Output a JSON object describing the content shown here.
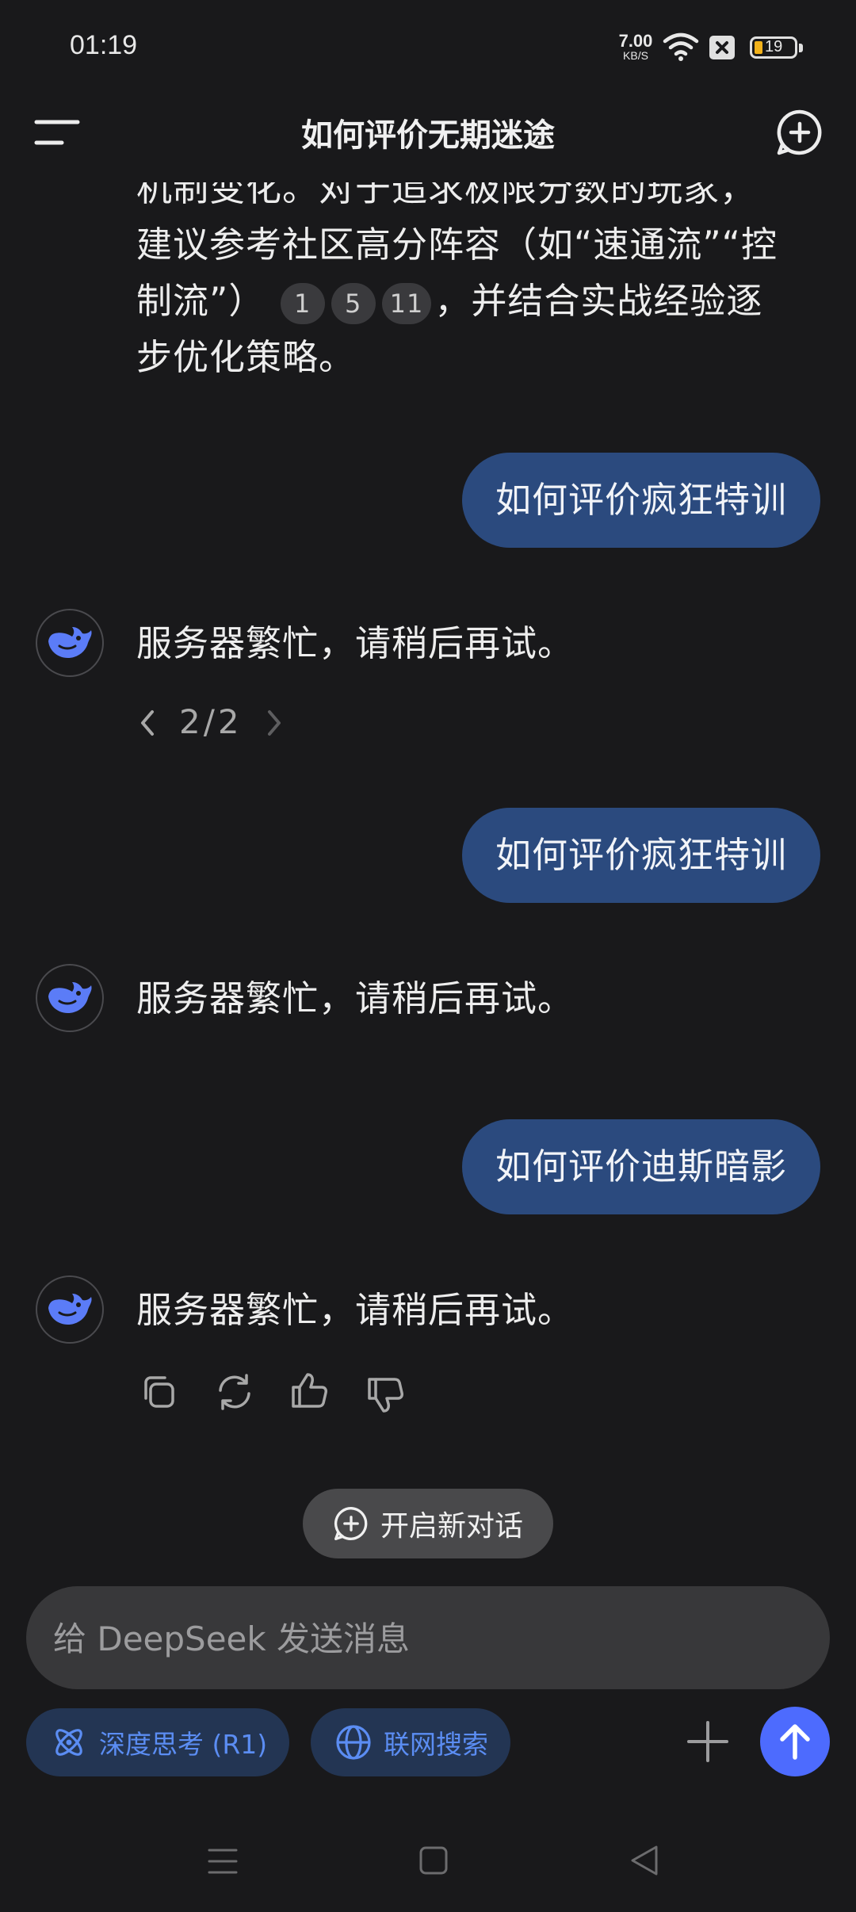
{
  "status_bar": {
    "time": "01:19",
    "net_speed_value": "7.00",
    "net_speed_unit": "KB/S",
    "battery_level": "19"
  },
  "header": {
    "title": "如何评价无期迷途"
  },
  "messages": {
    "partial_answer": {
      "line1": "机制变化。对于追求极限分数的玩家，",
      "line2": "建议参考社区高分阵容（如“速通流”“控",
      "line3_prefix": "制流”）",
      "line3_suffix": "，并结合实战经验逐",
      "line4": "步优化策略。",
      "citations": [
        "1",
        "5",
        "11"
      ]
    },
    "user_1": "如何评价疯狂特训",
    "ai_1": "服务器繁忙，请稍后再试。",
    "ai_1_pager": "2/2",
    "user_2": "如何评价疯狂特训",
    "ai_2": "服务器繁忙，请稍后再试。",
    "user_3": "如何评价迪斯暗影",
    "ai_3": "服务器繁忙，请稍后再试。"
  },
  "new_chat_label": "开启新对话",
  "composer": {
    "placeholder": "给 DeepSeek 发送消息",
    "deep_think_label": "深度思考 (R1)",
    "web_search_label": "联网搜索"
  },
  "colors": {
    "background": "#19191b",
    "user_bubble": "#2b4a7e",
    "accent_blue": "#4d6bfe",
    "toggle_bg": "#233553",
    "toggle_text": "#5b8df3",
    "battery_fill": "#f2b21b"
  }
}
